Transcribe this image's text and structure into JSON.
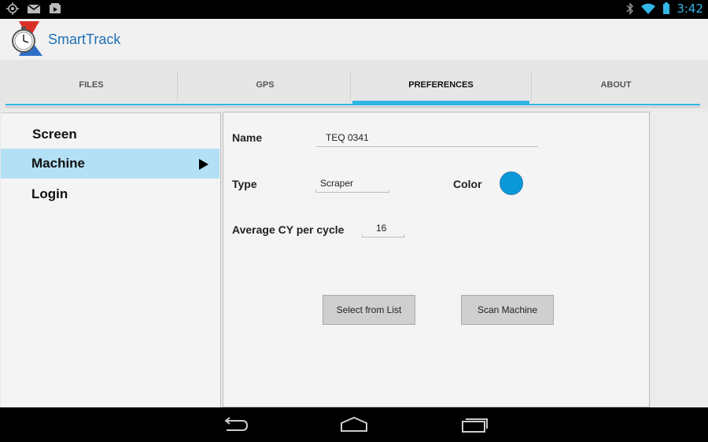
{
  "status_bar": {
    "time": "3:42",
    "icons": [
      "location-icon",
      "mail-icon",
      "media-icon",
      "bluetooth-icon",
      "wifi-icon",
      "battery-icon"
    ]
  },
  "app": {
    "title": "SmartTrack",
    "logo_icon": "stopwatch-logo-icon"
  },
  "tabs": [
    {
      "label": "FILES"
    },
    {
      "label": "GPS"
    },
    {
      "label": "PREFERENCES"
    },
    {
      "label": "ABOUT"
    }
  ],
  "sidebar": {
    "items": [
      {
        "label": "Screen"
      },
      {
        "label": "Machine"
      },
      {
        "label": "Login"
      }
    ]
  },
  "machine_form": {
    "name_label": "Name",
    "name_value": "TEQ 0341",
    "type_label": "Type",
    "type_value": "Scraper",
    "color_label": "Color",
    "color_value": "#0a97d8",
    "cycle_label": "Average CY per cycle",
    "cycle_value": "16",
    "select_button": "Select from List",
    "scan_button": "Scan Machine"
  },
  "colors": {
    "accent": "#33b5e5",
    "selected_row": "#b4e0f5",
    "title": "#1f6fb8"
  },
  "nav_bar": {
    "icons": [
      "back-icon",
      "home-icon",
      "recents-icon"
    ]
  }
}
